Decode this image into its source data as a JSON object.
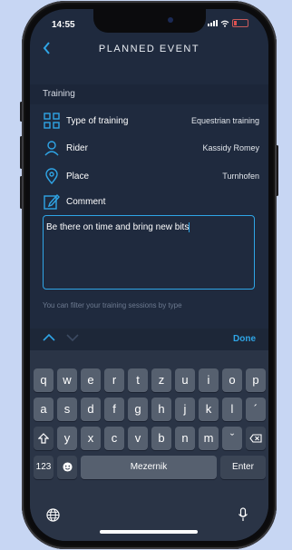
{
  "status": {
    "time": "14:55"
  },
  "header": {
    "back_icon": "chevron-left-icon",
    "title": "PLANNED EVENT"
  },
  "section": {
    "label": "Training"
  },
  "rows": [
    {
      "label": "Type of training",
      "value": "Equestrian training",
      "icon": "grid-icon"
    },
    {
      "label": "Rider",
      "value": "Kassidy Romey",
      "icon": "person-icon"
    },
    {
      "label": "Place",
      "value": "Turnhofen",
      "icon": "location-pin-icon"
    },
    {
      "label": "Comment",
      "value": "",
      "icon": "edit-icon"
    }
  ],
  "comment": {
    "text": "Be there on time and bring new bits"
  },
  "hint": "You can filter your training sessions by type",
  "accessory": {
    "done": "Done"
  },
  "keyboard": {
    "row1": [
      "q",
      "w",
      "e",
      "r",
      "t",
      "z",
      "u",
      "i",
      "o",
      "p"
    ],
    "row2": [
      "a",
      "s",
      "d",
      "f",
      "g",
      "h",
      "j",
      "k",
      "l",
      "´"
    ],
    "row3": [
      "y",
      "x",
      "c",
      "v",
      "b",
      "n",
      "m",
      "ˇ"
    ],
    "numbers": "123",
    "space": "Mezernik",
    "enter": "Enter"
  },
  "colors": {
    "accent": "#2fa5e6",
    "background": "#1f2a3e"
  }
}
